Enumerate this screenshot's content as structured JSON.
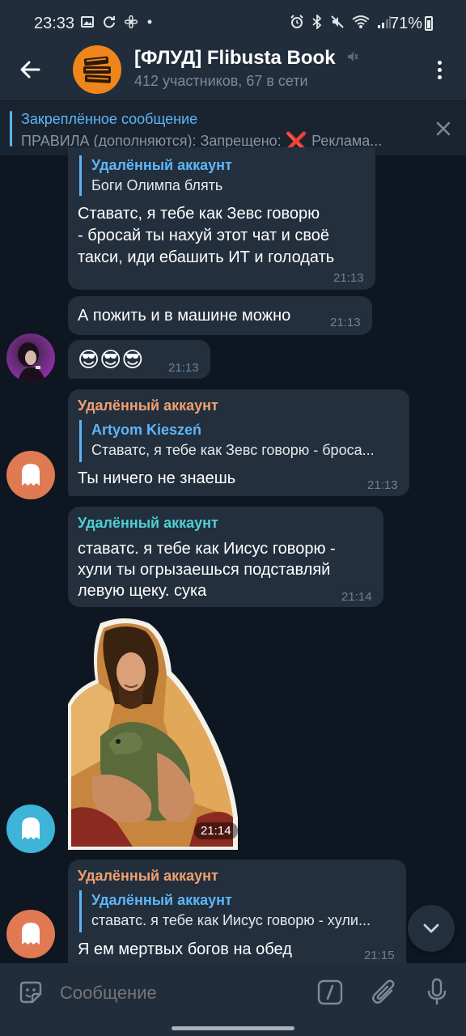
{
  "status_bar": {
    "time": "23:33",
    "battery": "71%",
    "left_icons": [
      "image-icon",
      "sync-icon",
      "fan-icon",
      "dot"
    ],
    "right_icons": [
      "alarm-icon",
      "bluetooth-icon",
      "mute-icon",
      "wifi-icon",
      "signal-icon"
    ]
  },
  "header": {
    "title": "[ФЛУД] Flibusta Book",
    "subtitle": "412 участников, 67 в сети",
    "avatar_color": "#f0851c"
  },
  "pinned": {
    "title": "Закреплённое сообщение",
    "text_before": "ПРАВИЛА (дополняются):  Запрещено: ",
    "emoji": "❌",
    "text_after": " Реклама..."
  },
  "messages": [
    {
      "reply_name": "Удалённый аккаунт",
      "reply_text": "Боги Олимпа блять",
      "lines": [
        "Ставатс, я тебе как Зевс говорю",
        "- бросай ты нахуй этот чат и своё",
        "такси, иди ебашить ИТ и голодать"
      ],
      "time": "21:13"
    },
    {
      "text": "А пожить и в машине можно",
      "time": "21:13"
    },
    {
      "text": "😎😎😎",
      "time": "21:13"
    },
    {
      "sender": "Удалённый аккаунт",
      "sender_color": "#f0a070",
      "reply_name": "Artyom Kieszeń",
      "reply_text": "Ставатс, я тебе как Зевс говорю - броса...",
      "text": "Ты ничего не знаешь",
      "time": "21:13"
    },
    {
      "sender": "Удалённый аккаунт",
      "sender_color": "#4fcfd2",
      "lines": [
        "ставатс. я тебе как Иисус говорю -",
        "хули ты огрызаешься подставляй",
        "левую щеку. сука"
      ],
      "time": "21:14"
    },
    {
      "sticker": "jesus-with-dinosaur-sticker",
      "time": "21:14"
    },
    {
      "sender": "Удалённый аккаунт",
      "sender_color": "#f0a070",
      "reply_name": "Удалённый аккаунт",
      "reply_text": "ставатс. я тебе как Иисус говорю - хули...",
      "text": "Я ем мертвых богов на обед",
      "time": "21:15"
    }
  ],
  "input": {
    "placeholder": "Сообщение"
  },
  "colors": {
    "background": "#0e1621",
    "bubble": "#232f3d",
    "bar": "#212d3b",
    "accent": "#5eb5f7"
  }
}
